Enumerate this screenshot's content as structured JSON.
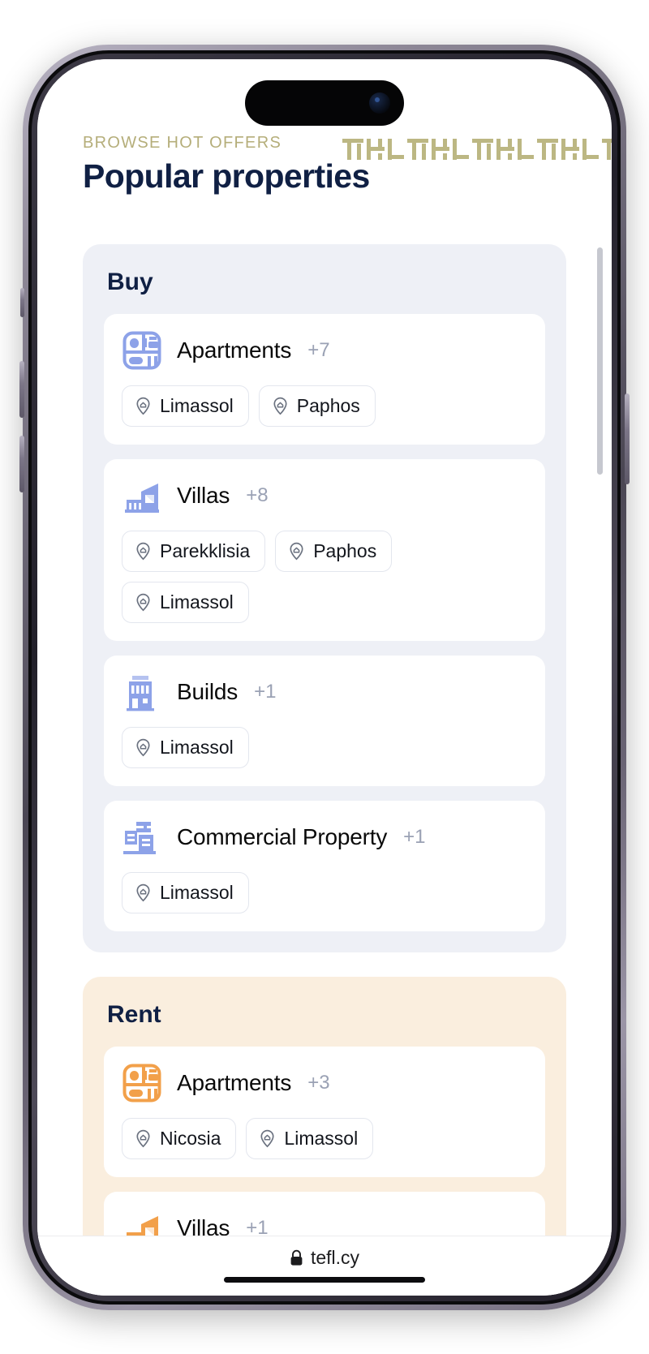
{
  "browser": {
    "url": "tefl.cy",
    "lock_icon": "lock-icon"
  },
  "header": {
    "eyebrow": "BROWSE HOT OFFERS",
    "title": "Popular properties",
    "eyebrow_color": "#b5ae7a",
    "title_color": "#102044",
    "decoration": "geometric-pattern-strip"
  },
  "groups": [
    {
      "title": "Buy",
      "accent": "#8da2e8",
      "background": "#eef0f6",
      "categories": [
        {
          "name": "Apartments",
          "count": "+7",
          "icon": "apartments-floorplan-icon",
          "locations": [
            "Limassol",
            "Paphos"
          ]
        },
        {
          "name": "Villas",
          "count": "+8",
          "icon": "villa-house-icon",
          "locations": [
            "Parekklisia",
            "Paphos",
            "Limassol"
          ]
        },
        {
          "name": "Builds",
          "count": "+1",
          "icon": "building-block-icon",
          "locations": [
            "Limassol"
          ]
        },
        {
          "name": "Commercial Property",
          "count": "+1",
          "icon": "commercial-property-icon",
          "locations": [
            "Limassol"
          ]
        }
      ]
    },
    {
      "title": "Rent",
      "accent": "#f5a councils",
      "background": "#faeede",
      "categories": [
        {
          "name": "Apartments",
          "count": "+3",
          "icon": "apartments-floorplan-icon",
          "locations": [
            "Nicosia",
            "Limassol"
          ]
        },
        {
          "name": "Villas",
          "count": "+1",
          "icon": "villa-house-icon",
          "locations": []
        }
      ]
    }
  ],
  "chip_icon": "location-pin-house-icon"
}
